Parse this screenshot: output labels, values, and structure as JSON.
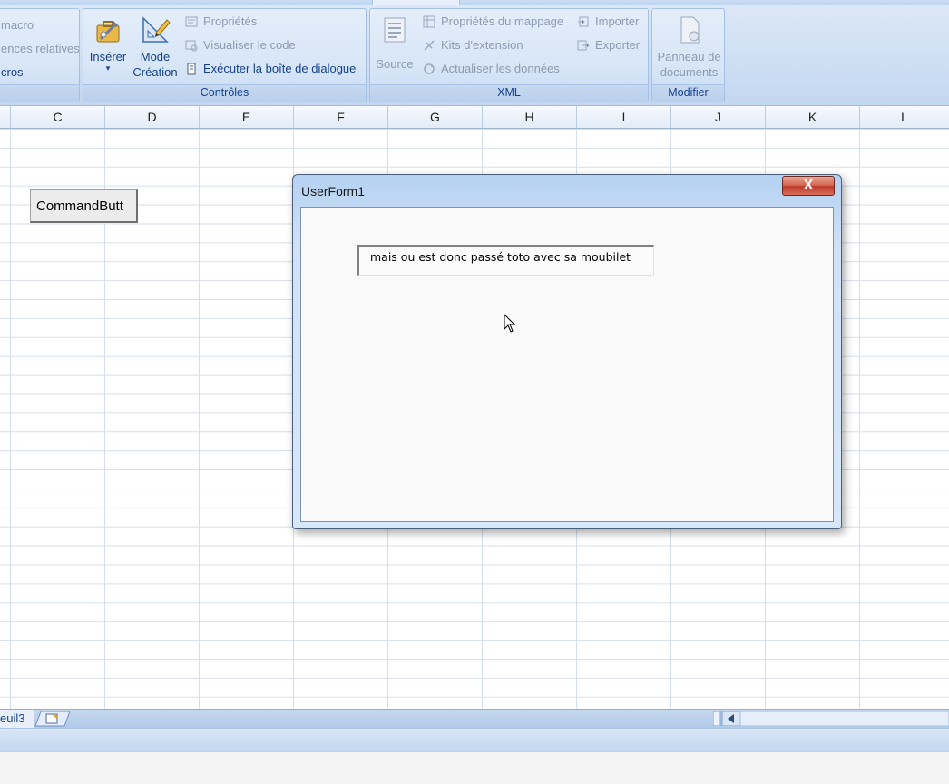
{
  "ribbon": {
    "macros_group": {
      "items": [
        "macro",
        "ences relatives",
        "cros"
      ]
    },
    "controls_group": {
      "insert_label": "Insérer",
      "insert_arrow": "▾",
      "design_mode_label_1": "Mode",
      "design_mode_label_2": "Création",
      "properties": "Propriétés",
      "view_code": "Visualiser le code",
      "run_dialog": "Exécuter la boîte de dialogue",
      "group_label": "Contrôles"
    },
    "xml_group": {
      "source": "Source",
      "map_properties": "Propriétés du mappage",
      "expansion_packs": "Kits d'extension",
      "refresh_data": "Actualiser les données",
      "import": "Importer",
      "export": "Exporter",
      "group_label": "XML"
    },
    "modify_group": {
      "doc_panel_1": "Panneau de",
      "doc_panel_2": "documents",
      "group_label": "Modifier"
    }
  },
  "columns": [
    "C",
    "D",
    "E",
    "F",
    "G",
    "H",
    "I",
    "J",
    "K",
    "L"
  ],
  "sheet": {
    "command_button_label": "CommandButt"
  },
  "sheet_tabs": {
    "current_tab": "euil3"
  },
  "dialog": {
    "title": "UserForm1",
    "close_glyph": "X",
    "textbox_value": "mais ou est donc passé toto avec sa moubilet"
  },
  "colors": {
    "ribbon_text": "#15428b",
    "disabled_text": "#8d9bb1",
    "close_button": "#c0392b"
  },
  "icons": {
    "insert": "toolbox-icon",
    "design_mode": "ruler-pencil-icon",
    "source": "xml-source-icon",
    "doc_panel": "document-panel-icon"
  }
}
